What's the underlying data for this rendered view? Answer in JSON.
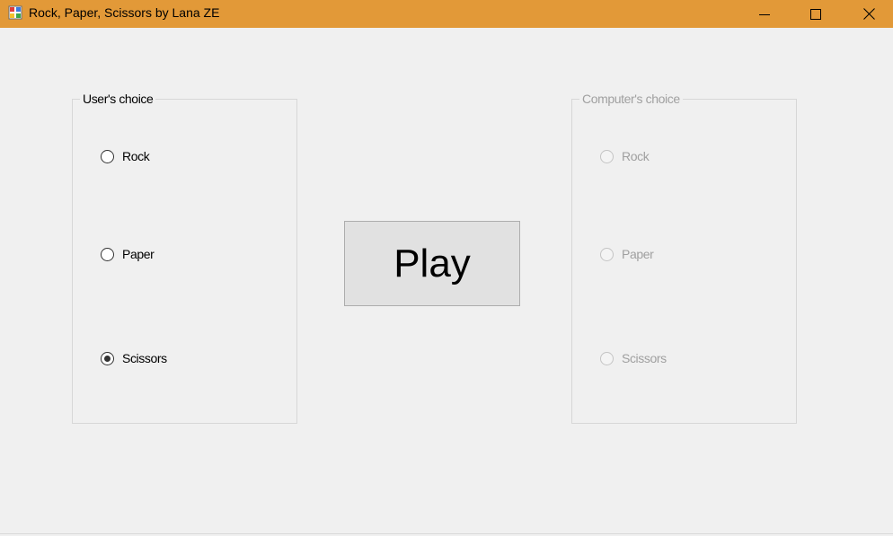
{
  "window": {
    "title": "Rock, Paper, Scissors by Lana ZE",
    "titlebar_color": "#e29938",
    "icons": {
      "app": "app-window-icon",
      "minimize": "minimize-icon",
      "maximize": "maximize-icon",
      "close": "close-icon"
    }
  },
  "user_choice": {
    "legend": "User's choice",
    "options": [
      {
        "label": "Rock",
        "checked": false
      },
      {
        "label": "Paper",
        "checked": false
      },
      {
        "label": "Scissors",
        "checked": true
      }
    ]
  },
  "computer_choice": {
    "legend": "Computer's choice",
    "disabled": true,
    "options": [
      {
        "label": "Rock",
        "checked": false
      },
      {
        "label": "Paper",
        "checked": false
      },
      {
        "label": "Scissors",
        "checked": false
      }
    ]
  },
  "play_button": {
    "label": "Play"
  }
}
